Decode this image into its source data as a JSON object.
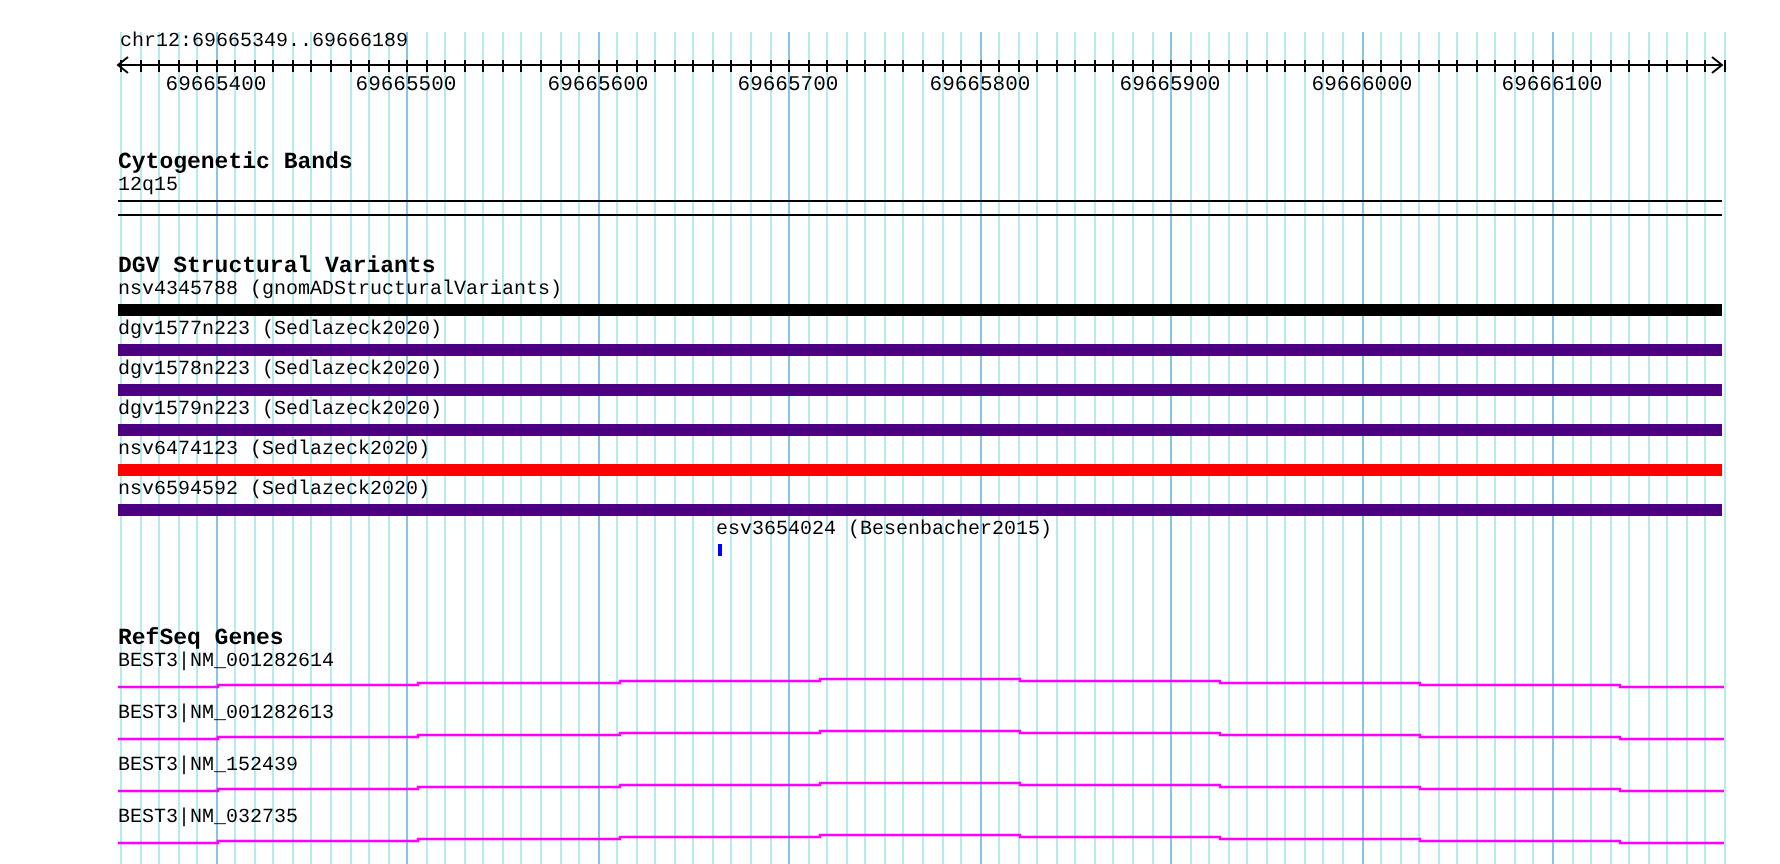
{
  "ruler": {
    "region": "chr12:69665349..69666189",
    "ticks": [
      "69665400",
      "69665500",
      "69665600",
      "69665700",
      "69665800",
      "69665900",
      "69666000",
      "69666100"
    ]
  },
  "tracks": [
    {
      "kind": "cytoband",
      "title": "Cytogenetic Bands",
      "features": [
        {
          "label": "12q15"
        }
      ]
    },
    {
      "kind": "variants",
      "title": "DGV Structural Variants",
      "features": [
        {
          "kind": "bar",
          "label": "nsv4345788 (gnomADStructuralVariants)",
          "color": "#000000"
        },
        {
          "kind": "bar",
          "label": "dgv1577n223 (Sedlazeck2020)",
          "color": "#4b0082"
        },
        {
          "kind": "bar",
          "label": "dgv1578n223 (Sedlazeck2020)",
          "color": "#4b0082"
        },
        {
          "kind": "bar",
          "label": "dgv1579n223 (Sedlazeck2020)",
          "color": "#4b0082"
        },
        {
          "kind": "bar",
          "label": "nsv6474123 (Sedlazeck2020)",
          "color": "#ff0000"
        },
        {
          "kind": "bar",
          "label": "nsv6594592 (Sedlazeck2020)",
          "color": "#4b0082"
        },
        {
          "kind": "point",
          "label": "esv3654024 (Besenbacher2015)",
          "color": "#0000ff"
        }
      ]
    },
    {
      "kind": "genes",
      "title": "RefSeq Genes",
      "features": [
        {
          "label": "BEST3|NM_001282614"
        },
        {
          "label": "BEST3|NM_001282613"
        },
        {
          "label": "BEST3|NM_152439"
        },
        {
          "label": "BEST3|NM_032735"
        }
      ]
    }
  ]
}
